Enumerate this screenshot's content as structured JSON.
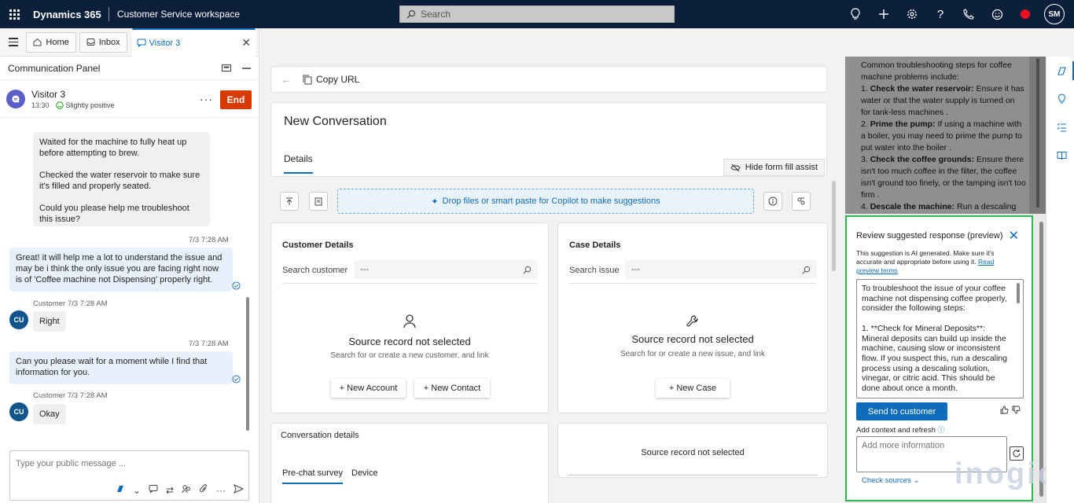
{
  "topbar": {
    "brand": "Dynamics 365",
    "app_name": "Customer Service workspace",
    "search_placeholder": "Search",
    "user_initials": "SM"
  },
  "tabs": {
    "home": "Home",
    "inbox": "Inbox",
    "active": "Visitor 3"
  },
  "comm_panel": {
    "title": "Communication Panel",
    "visitor_name": "Visitor 3",
    "visitor_time": "13:30",
    "sentiment": "Slightly positive",
    "end_label": "End",
    "messages": {
      "m1": "Waited for the machine to fully heat up before attempting to brew.\n\nChecked the water reservoir to make sure it's filled and properly seated.\n\nCould you please help me troubleshoot this issue?",
      "ts1": "7/3 7:28 AM",
      "m2": "Great! it will help me a lot to understand the issue and may be i think the only issue you are facing right now is of 'Coffee machine not Dispensing' properly right.",
      "cust_label_1": "Customer 7/3 7:28 AM",
      "cu_initials": "CU",
      "m3": "Right",
      "ts2": "7/3 7:28 AM",
      "m4": "Can you please wait for a moment while I find that information for you.",
      "cust_label_2": "Customer 7/3 7:28 AM",
      "m5": "Okay"
    },
    "composer_placeholder": "Type your public message ..."
  },
  "main": {
    "copy_url": "Copy URL",
    "conversation_title": "New Conversation",
    "details_tab": "Details",
    "hide_form_fill": "Hide form fill assist",
    "dropzone": "Drop files or smart paste for Copilot to make suggestions",
    "customer": {
      "heading": "Customer Details",
      "search_label": "Search customer",
      "search_value": "---",
      "not_selected": "Source record not selected",
      "sub": "Search for or create a new customer, and link",
      "btn_account": "+ New Account",
      "btn_contact": "+ New Contact"
    },
    "case": {
      "heading": "Case Details",
      "search_label": "Search issue",
      "search_value": "---",
      "not_selected": "Source record not selected",
      "sub": "Search for or create a new issue, and link",
      "btn_case": "+ New Case"
    },
    "conversation_details": {
      "heading": "Conversation details",
      "tab_prechat": "Pre-chat survey",
      "tab_device": "Device"
    },
    "bottom_source": "Source record not selected"
  },
  "copilot": {
    "intro": "Common troubleshooting steps for coffee machine problems include:",
    "steps": [
      {
        "n": "1.",
        "b": "Check the water reservoir:",
        "t": "Ensure it has water or that the water supply is turned on for tank-less machines ."
      },
      {
        "n": "2.",
        "b": "Prime the pump:",
        "t": "If using a machine with a boiler, you may need to prime the pump to put water into the boiler ."
      },
      {
        "n": "3.",
        "b": "Check the coffee grounds:",
        "t": "Ensure there isn't too much coffee in the filter, the coffee isn't ground too finely, or the tamping isn't too firm ."
      },
      {
        "n": "4.",
        "b": "Descale the machine:",
        "t": "Run a descaling"
      }
    ]
  },
  "review": {
    "title": "Review suggested response (preview)",
    "note": "This suggestion is AI generated. Make sure it's accurate and appropriate before using it.",
    "note_link": "Read preview terms",
    "response": "To troubleshoot the issue of your coffee machine not dispensing coffee properly, consider the following steps:\n\n1. **Check for Mineral Deposits**: Mineral deposits can build up inside the machine, causing slow or inconsistent flow. If you suspect this, run a descaling process using a descaling solution, vinegar, or citric acid. This should be done about once a month.",
    "send": "Send to customer",
    "add_context": "Add context and refresh",
    "add_placeholder": "Add more information",
    "check_sources": "Check sources"
  },
  "watermark": "inogic"
}
